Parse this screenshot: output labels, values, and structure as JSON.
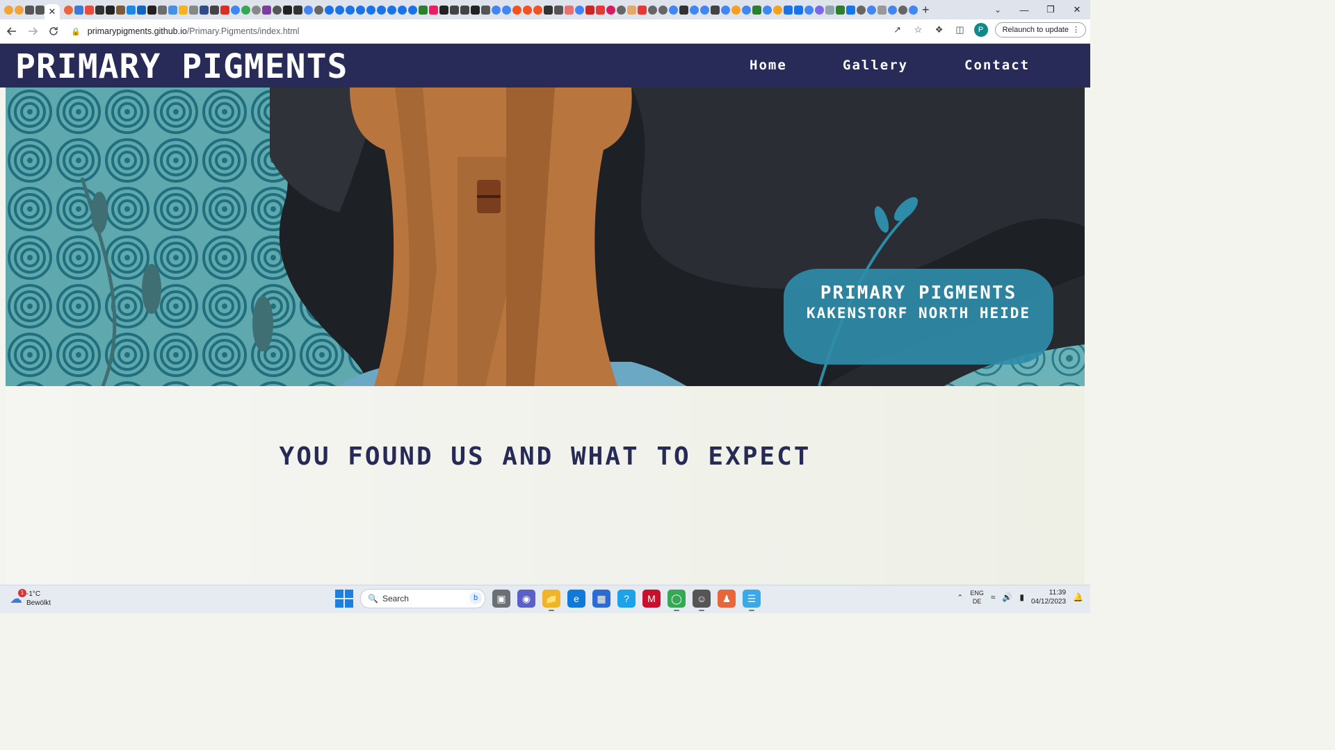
{
  "browser": {
    "active_tab_close": "✕",
    "new_tab": "+",
    "tab_search": "⌄",
    "window": {
      "minimize": "—",
      "restore": "❐",
      "close": "✕"
    },
    "url_host": "primarypigments.github.io",
    "url_path": "/Primary.Pigments/index.html",
    "relaunch_label": "Relaunch to update",
    "profile_initial": "P"
  },
  "site": {
    "logo": "PRIMARY PIGMENTS",
    "nav": [
      "Home",
      "Gallery",
      "Contact"
    ],
    "hero_title": "PRIMARY PIGMENTS",
    "hero_subtitle": "KAKENSTORF NORTH HEIDE",
    "section_heading": "YOU FOUND US AND WHAT TO EXPECT"
  },
  "taskbar": {
    "weather_temp": "-1°C",
    "weather_desc": "Bewölkt",
    "weather_badge": "1",
    "search_placeholder": "Search",
    "lang_top": "ENG",
    "lang_bottom": "DE",
    "time": "11:39",
    "date": "04/12/2023"
  },
  "colors": {
    "header_bg": "#282a58",
    "hero_card": "#2f8ca8",
    "heading": "#262a54"
  }
}
